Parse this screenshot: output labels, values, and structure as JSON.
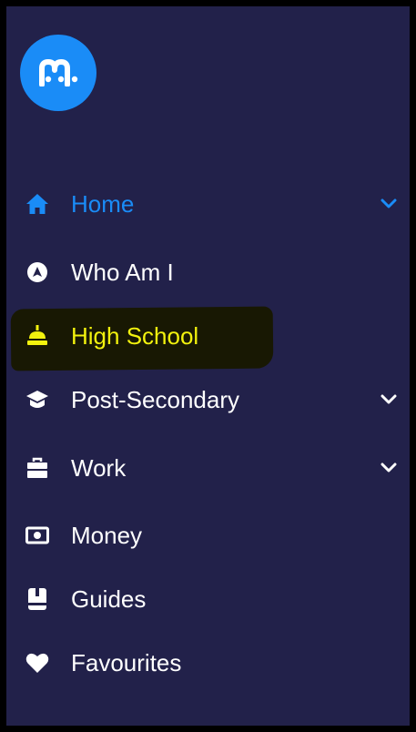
{
  "brand": {
    "logo_icon": "m-logo-icon",
    "color": "#1a8cf7"
  },
  "colors": {
    "panel_background": "#22214a",
    "active": "#1a8cf7",
    "highlight_text": "#f2f20e",
    "text": "#ffffff"
  },
  "nav": {
    "items": [
      {
        "label": "Home",
        "icon": "home-icon",
        "active": true,
        "has_dropdown": true
      },
      {
        "label": "Who Am I",
        "icon": "compass-icon",
        "active": false,
        "has_dropdown": false
      },
      {
        "label": "High School",
        "icon": "school-icon",
        "active": false,
        "has_dropdown": false,
        "highlighted": true
      },
      {
        "label": "Post-Secondary",
        "icon": "graduation-cap-icon",
        "active": false,
        "has_dropdown": true
      },
      {
        "label": "Work",
        "icon": "briefcase-icon",
        "active": false,
        "has_dropdown": true
      },
      {
        "label": "Money",
        "icon": "money-icon",
        "active": false,
        "has_dropdown": false
      },
      {
        "label": "Guides",
        "icon": "book-icon",
        "active": false,
        "has_dropdown": false
      },
      {
        "label": "Favourites",
        "icon": "heart-icon",
        "active": false,
        "has_dropdown": false
      }
    ]
  }
}
